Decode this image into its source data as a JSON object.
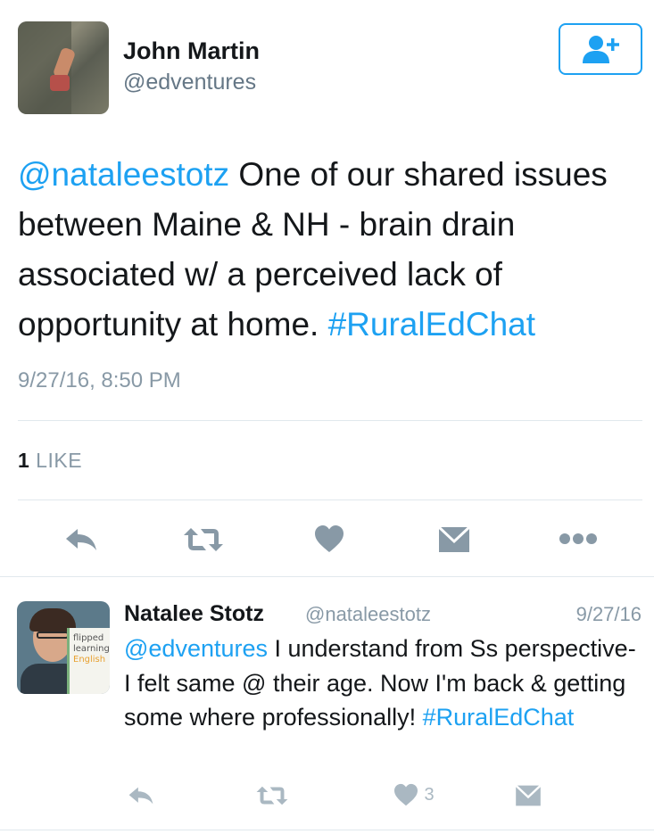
{
  "tweet": {
    "author_name": "John Martin",
    "author_handle": "@edventures",
    "mention": "@nataleestotz",
    "body": " One of our shared issues between Maine & NH - brain drain associated w/ a  perceived lack of opportunity at home. ",
    "hashtag": "#RuralEdChat",
    "timestamp": "9/27/16, 8:50 PM",
    "like_count": "1",
    "like_label": " LIKE"
  },
  "icons": {
    "follow": "person-add-icon",
    "reply": "reply-icon",
    "retweet": "retweet-icon",
    "like": "heart-icon",
    "dm": "envelope-icon",
    "more": "more-dots-icon"
  },
  "reply": {
    "author_name": "Natalee Stotz",
    "author_handle": "@nataleestotz",
    "date": "9/27/16",
    "mention": "@edventures",
    "body": " I understand from Ss perspective- I felt same @ their age. Now I'm back & getting some where professionally! ",
    "hashtag": "#RuralEdChat",
    "like_count": "3",
    "avatar_book_lines": [
      "flipped",
      "learning",
      "English"
    ]
  },
  "colors": {
    "accent": "#1da1f2",
    "icon_gray": "#8899a6",
    "icon_light": "#aab8c2",
    "text": "#14171a"
  }
}
